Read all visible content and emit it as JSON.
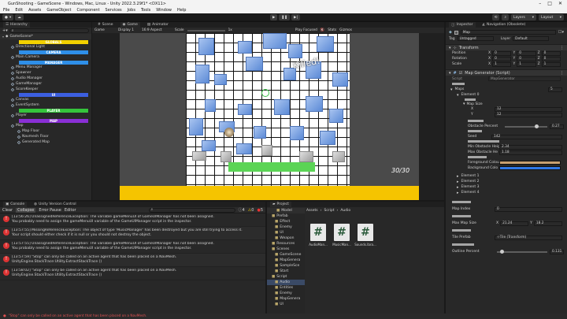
{
  "window": {
    "title": "GunShooting - GameScene - Windows, Mac, Linux - Unity 2022.3.29f1* <DX11>"
  },
  "menu": [
    "File",
    "Edit",
    "Assets",
    "GameObject",
    "Component",
    "Services",
    "Jobs",
    "Tools",
    "Window",
    "Help"
  ],
  "toolbar": {
    "layers": "Layers",
    "layout": "Layout"
  },
  "hierarchy": {
    "tab": "Hierarchy",
    "scene": "GameScene*",
    "items": [
      {
        "type": "sep",
        "label": "GLOBALS",
        "color": "#f3d100"
      },
      {
        "type": "item",
        "label": "Directional Light"
      },
      {
        "type": "sep",
        "label": "CAMERA",
        "color": "#2f8fe8"
      },
      {
        "type": "item",
        "label": "Main Camera"
      },
      {
        "type": "sep",
        "label": "MANAGER",
        "color": "#2f8fe8"
      },
      {
        "type": "item",
        "label": "Menu Manager"
      },
      {
        "type": "item",
        "label": "Spawner"
      },
      {
        "type": "item",
        "label": "Audio Manager"
      },
      {
        "type": "item",
        "label": "GameManager"
      },
      {
        "type": "item",
        "label": "ScoreKeeper"
      },
      {
        "type": "sep",
        "label": "UI",
        "color": "#3c5fe0"
      },
      {
        "type": "item",
        "label": "Canvas"
      },
      {
        "type": "item",
        "label": "EventSystem"
      },
      {
        "type": "sep",
        "label": "PLAYER",
        "color": "#35c43c"
      },
      {
        "type": "item",
        "label": "Player"
      },
      {
        "type": "sep",
        "label": "MAP",
        "color": "#8a2fd6"
      },
      {
        "type": "item",
        "label": "Map"
      },
      {
        "type": "child",
        "label": "Map Floor"
      },
      {
        "type": "child",
        "label": "Navmesh Floor"
      },
      {
        "type": "child",
        "label": "Generated Map"
      }
    ]
  },
  "scene_tabs": {
    "scene": "Scene",
    "game": "Game",
    "animator": "Animator"
  },
  "game_bar": {
    "mode": "Game",
    "display": "Display 1",
    "aspect": "16:9 Aspect",
    "scale_label": "Scale",
    "scale_value": "1x",
    "play_focused": "Play Focused",
    "stats": "Stats",
    "gizmos": "Gizmos"
  },
  "game_view": {
    "killed": "Killed!",
    "ammo": "30/30"
  },
  "console": {
    "tab_console": "Console",
    "tab_vc": "Unity Version Control",
    "clear": "Clear",
    "collapse": "Collapse",
    "error_pause": "Error Pause",
    "editor": "Editor",
    "counts": [
      "4",
      "0",
      "5"
    ],
    "entries": [
      {
        "l1": "[13:56:26] UnassignedReferenceException: The variable gameMenuUI of GameUIManager has not been assigned.",
        "l2": "You probably need to assign the gameMenuUI variable of the GameUIManager script in the inspector."
      },
      {
        "l1": "[13:57:55] MissingReferenceException: The object of type 'MusicManager' has been destroyed but you are still trying to access it.",
        "l2": "Your script should either check if it is null or you should not destroy the object."
      },
      {
        "l1": "[13:57:55] UnassignedReferenceException: The variable gameMenuUI of GameUIManager has not been assigned.",
        "l2": "You probably need to assign the gameMenuUI variable of the GameUIManager script in the inspector."
      },
      {
        "l1": "[13:57:59] \"Stop\" can only be called on an active agent that has been placed on a NavMesh.",
        "l2": "UnityEngine.StackTrace:Utility.ExtractStackTrace ()"
      },
      {
        "l1": "[13:58:02] \"Stop\" can only be called on an active agent that has been placed on a NavMesh.",
        "l2": "UnityEngine.StackTrace:Utility.ExtractStackTrace ()"
      }
    ],
    "statusbar": "\"Stop\" can only be called on an active agent that has been placed on a NavMesh."
  },
  "project": {
    "tab": "Project",
    "tree": [
      "Prefab",
      "Effect",
      "Enemy",
      "UI",
      "Weapon",
      "Resources",
      "Scenes",
      "GameScene",
      "MapGenera",
      "SampleSce",
      "Start",
      "Script",
      "Audio",
      "Entities",
      "Enemy",
      "MapGenera",
      "UI"
    ],
    "breadcrumb": [
      "Assets",
      "Script",
      "Audio"
    ],
    "files": [
      {
        "name": "AudioMan..."
      },
      {
        "name": "MusicMan..."
      },
      {
        "name": "Sounds.lbra..."
      }
    ],
    "tree_top": "Model"
  },
  "inspector": {
    "tab": "Inspector",
    "tab2": "Navigation (Obsolete)",
    "object_name": "Map",
    "tag_label": "Tag",
    "tag": "Untagged",
    "layer_label": "Layer",
    "layer": "Default",
    "transform": "Transform",
    "position": {
      "label": "Position",
      "x": "0",
      "y": "0",
      "z": "0"
    },
    "rotation": {
      "label": "Rotation",
      "x": "0",
      "y": "0",
      "z": "0"
    },
    "scale": {
      "label": "Scale",
      "x": "1",
      "y": "1",
      "z": "1"
    },
    "script_comp": "Map Generator (Script)",
    "script_label": "Script",
    "script_value": "MapGenerator",
    "maps_label": "Maps",
    "maps_count": "5",
    "element0": "Element 0",
    "map_size": {
      "x_label": "X",
      "x": "12",
      "y_label": "Y",
      "y": "12"
    },
    "obstacle_percent_label": "Obstacle Percent",
    "obstacle_percent": "0.27",
    "seed_label": "Seed",
    "seed": "142",
    "min_h_label": "Min Obstacle Heig",
    "min_h": "2.34",
    "max_h_label": "Max Obstacle He",
    "max_h": "1.18",
    "fg_label": "Foreground Colou",
    "bg_label": "Background Colo",
    "elements": [
      "Element 1",
      "Element 2",
      "Element 3",
      "Element 4"
    ],
    "map_index_label": "Map Index",
    "map_index": "0",
    "max_map_size_label": "Max Map Size",
    "max_x": "21.24",
    "max_y": "18.2",
    "tile_prefab_label": "Tile Prefab",
    "tile_prefab": "Tile (Transform)",
    "outline_label": "Outline Percent",
    "outline": "0.131",
    "accent": "#5a9cf0",
    "fg_color": "#c8a070",
    "bg_color": "#2f78e6"
  }
}
